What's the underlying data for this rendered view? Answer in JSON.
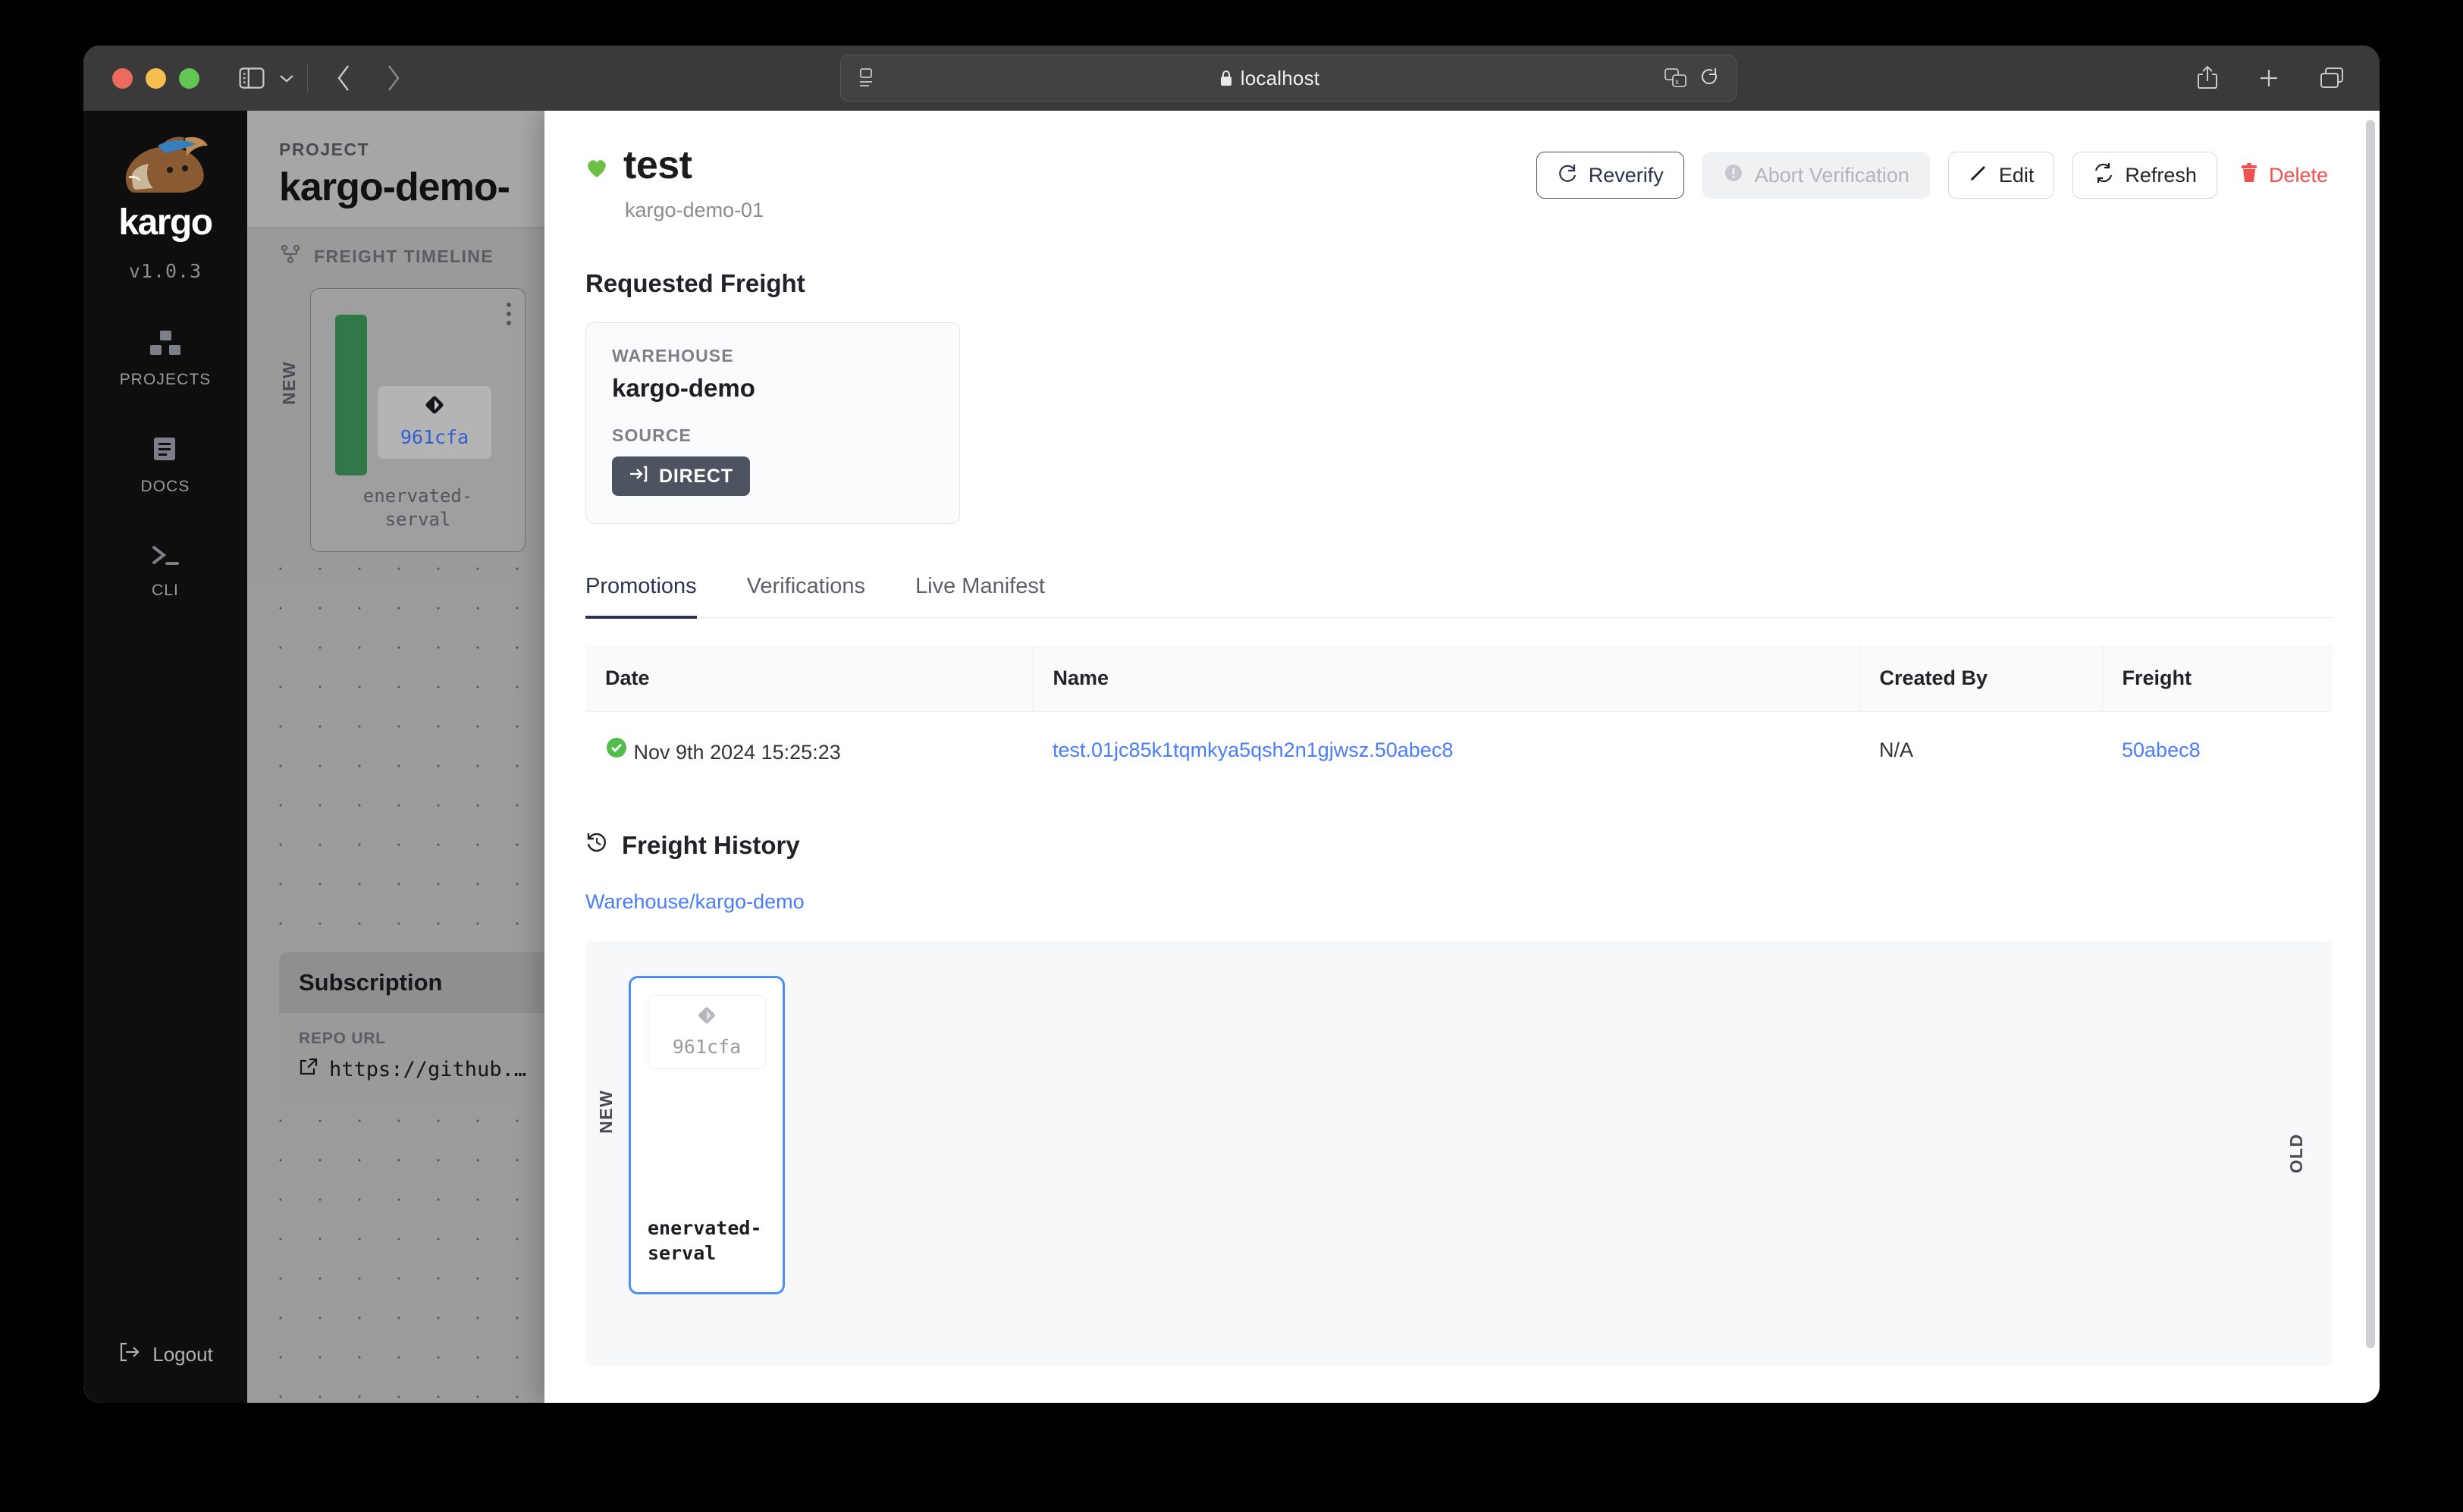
{
  "browser": {
    "url": "localhost",
    "icons": {
      "sidebar_toggle": "sidebar-toggle-icon",
      "sidebar_chevron": "chevron-down-icon",
      "back": "back-chevron-icon",
      "forward": "forward-chevron-icon",
      "reader": "reader-view-icon",
      "lock": "lock-icon",
      "translate": "translate-icon",
      "reload": "reload-icon",
      "share": "share-icon",
      "new_tab": "plus-icon",
      "tab_overview": "tab-overview-icon"
    }
  },
  "rail": {
    "brand": "kargo",
    "version": "v1.0.3",
    "items": [
      {
        "label": "PROJECTS",
        "icon": "boxes-icon"
      },
      {
        "label": "DOCS",
        "icon": "book-icon"
      },
      {
        "label": "CLI",
        "icon": "terminal-icon"
      }
    ],
    "logout": "Logout"
  },
  "project": {
    "eyebrow": "PROJECT",
    "name": "kargo-demo-",
    "timeline_label": "FREIGHT TIMELINE",
    "timeline_card": {
      "axis_label": "NEW",
      "hash": "961cfa",
      "name": "enervated-\nserval"
    },
    "subscription": {
      "title": "Subscription",
      "repo_label": "REPO URL",
      "repo_url": "https://github.…"
    }
  },
  "stage": {
    "title": "test",
    "subtitle": "kargo-demo-01",
    "health_icon": "heart-icon",
    "actions": [
      {
        "label": "Reverify",
        "icon": "refresh-cw-icon",
        "state": "outline"
      },
      {
        "label": "Abort Verification",
        "icon": "stop-circle-icon",
        "state": "disabled"
      },
      {
        "label": "Edit",
        "icon": "pencil-icon",
        "state": "default"
      },
      {
        "label": "Refresh",
        "icon": "sync-icon",
        "state": "default"
      },
      {
        "label": "Delete",
        "icon": "trash-icon",
        "state": "danger"
      }
    ],
    "requested_freight": {
      "heading": "Requested Freight",
      "warehouse_label": "WAREHOUSE",
      "warehouse": "kargo-demo",
      "source_label": "SOURCE",
      "source_badge": "DIRECT",
      "source_icon": "arrow-into-bracket-icon"
    },
    "tabs": [
      {
        "label": "Promotions",
        "active": true
      },
      {
        "label": "Verifications",
        "active": false
      },
      {
        "label": "Live Manifest",
        "active": false
      }
    ],
    "table": {
      "columns": [
        "Date",
        "Name",
        "Created By",
        "Freight"
      ],
      "rows": [
        {
          "status_icon": "check-circle-icon",
          "date": "Nov 9th 2024 15:25:23",
          "name": "test.01jc85k1tqmkya5qsh2n1gjwsz.50abec8",
          "created_by": "N/A",
          "freight": "50abec8"
        }
      ]
    },
    "freight_history": {
      "heading": "Freight History",
      "heading_icon": "history-icon",
      "link": "Warehouse/kargo-demo",
      "new_label": "NEW",
      "old_label": "OLD",
      "card": {
        "hash": "961cfa",
        "hash_icon": "git-commit-icon",
        "name_line1": "enervated-",
        "name_line2": "serval"
      }
    }
  },
  "colors": {
    "accent_blue": "#4a7dfb",
    "tab_active": "#2b3350",
    "danger": "#f2514f",
    "health_green": "#6dbe45",
    "success_green": "#52bd4a",
    "badge_slate": "#4d5361",
    "timeline_green": "#317849"
  }
}
